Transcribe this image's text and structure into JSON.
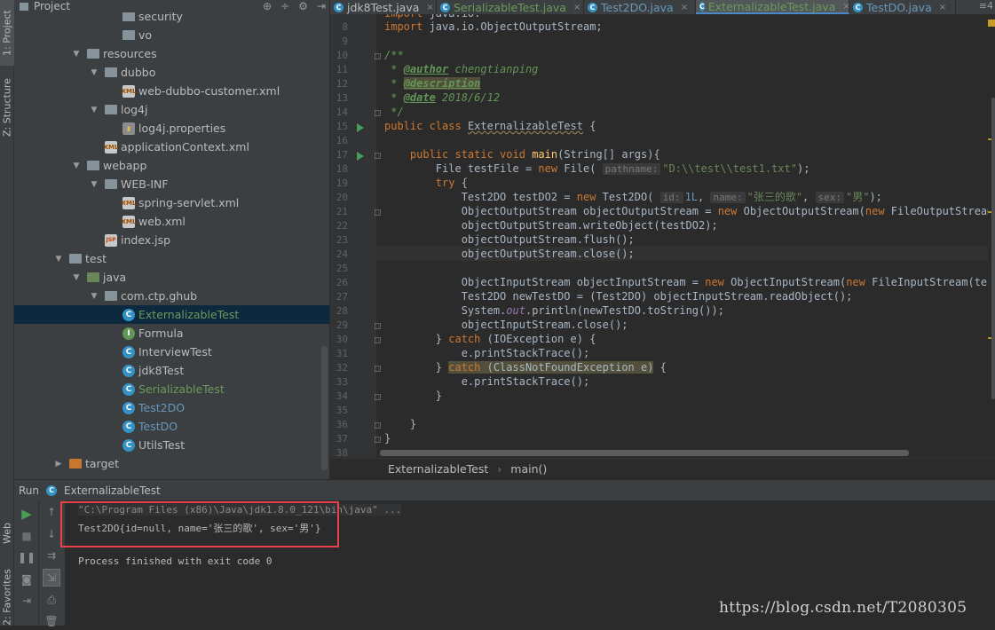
{
  "left_strip": {
    "tabs": [
      "1: Project",
      "Z: Structure",
      "Web",
      "2: Favorites"
    ]
  },
  "project": {
    "header": {
      "title": "Project"
    },
    "tree": [
      {
        "label": "security",
        "icon": "folder-icon",
        "indent": 3,
        "arrow": ""
      },
      {
        "label": "vo",
        "icon": "folder-icon",
        "indent": 3,
        "arrow": ""
      },
      {
        "label": "resources",
        "icon": "resources-folder-icon",
        "indent": 1,
        "arrow": "▼"
      },
      {
        "label": "dubbo",
        "icon": "folder-icon",
        "indent": 2,
        "arrow": "▼"
      },
      {
        "label": "web-dubbo-customer.xml",
        "icon": "xml-file-icon",
        "indent": 3,
        "arrow": ""
      },
      {
        "label": "log4j",
        "icon": "folder-icon",
        "indent": 2,
        "arrow": "▼"
      },
      {
        "label": "log4j.properties",
        "icon": "properties-file-icon",
        "indent": 3,
        "arrow": ""
      },
      {
        "label": "applicationContext.xml",
        "icon": "xml-file-icon",
        "indent": 2,
        "arrow": ""
      },
      {
        "label": "webapp",
        "icon": "folder-icon",
        "indent": 1,
        "arrow": "▼"
      },
      {
        "label": "WEB-INF",
        "icon": "folder-icon",
        "indent": 2,
        "arrow": "▼"
      },
      {
        "label": "spring-servlet.xml",
        "icon": "xml-file-icon",
        "indent": 3,
        "arrow": ""
      },
      {
        "label": "web.xml",
        "icon": "xml-file-icon",
        "indent": 3,
        "arrow": ""
      },
      {
        "label": "index.jsp",
        "icon": "jsp-file-icon",
        "indent": 2,
        "arrow": ""
      },
      {
        "label": "test",
        "icon": "folder-icon",
        "indent": 0,
        "arrow": "▼"
      },
      {
        "label": "java",
        "icon": "test-source-folder-icon",
        "indent": 1,
        "arrow": "▼"
      },
      {
        "label": "com.ctp.ghub",
        "icon": "package-icon",
        "indent": 2,
        "arrow": "▼"
      },
      {
        "label": "ExternalizableTest",
        "icon": "class-icon",
        "indent": 3,
        "arrow": "",
        "selected": true,
        "color": "green"
      },
      {
        "label": "Formula",
        "icon": "interface-icon",
        "indent": 3,
        "arrow": ""
      },
      {
        "label": "InterviewTest",
        "icon": "class-icon",
        "indent": 3,
        "arrow": ""
      },
      {
        "label": "jdk8Test",
        "icon": "class-icon",
        "indent": 3,
        "arrow": ""
      },
      {
        "label": "SerializableTest",
        "icon": "class-icon",
        "indent": 3,
        "arrow": "",
        "color": "green"
      },
      {
        "label": "Test2DO",
        "icon": "class-icon",
        "indent": 3,
        "arrow": "",
        "color": "blue"
      },
      {
        "label": "TestDO",
        "icon": "class-icon",
        "indent": 3,
        "arrow": "",
        "color": "blue"
      },
      {
        "label": "UtilsTest",
        "icon": "class-icon",
        "indent": 3,
        "arrow": ""
      },
      {
        "label": "target",
        "icon": "target-folder-icon",
        "indent": 0,
        "arrow": "▶"
      }
    ]
  },
  "editor": {
    "tabs": [
      {
        "label": "jdk8Test.java",
        "color": "normal"
      },
      {
        "label": "SerializableTest.java",
        "color": "green"
      },
      {
        "label": "Test2DO.java",
        "color": "blue"
      },
      {
        "label": "ExternalizableTest.java",
        "color": "green",
        "active": true
      },
      {
        "label": "TestDO.java",
        "color": "blue"
      }
    ],
    "tab_more": "≡4",
    "first_line": 8,
    "breadcrumb": {
      "class": "ExternalizableTest",
      "method": "main()"
    }
  },
  "run": {
    "label": "Run",
    "config": "ExternalizableTest",
    "console": {
      "cmd": "\"C:\\Program Files (x86)\\Java\\jdk1.8.0_121\\bin\\java\" ...",
      "output": "Test2DO{id=null, name='张三的歌', sex='男'}",
      "exit": "Process finished with exit code 0"
    }
  },
  "watermark": "https://blog.csdn.net/T2080305",
  "colors": {
    "accent": "#4a88c7",
    "highlight_box": "#e8414c",
    "run_green": "#499c54",
    "selection": "#0d293e"
  }
}
